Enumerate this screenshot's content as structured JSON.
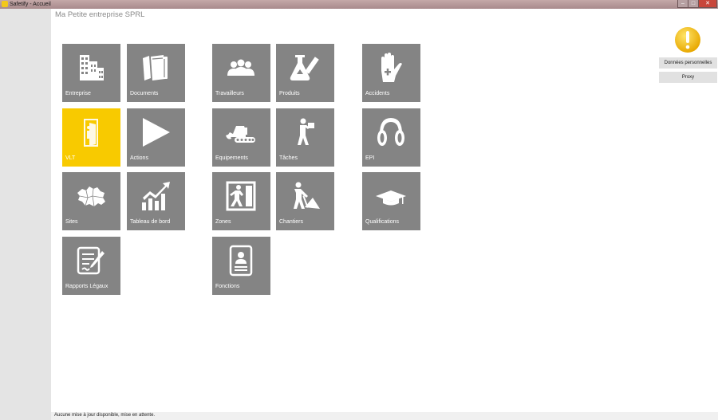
{
  "window": {
    "title": "Safetify - Accueil"
  },
  "company": {
    "name": "Ma Petite entreprise SPRL"
  },
  "tiles": {
    "entreprise": "Entreprise",
    "documents": "Documents",
    "travailleurs": "Travailleurs",
    "produits": "Produits",
    "accidents": "Accidents",
    "vlt": "VLT",
    "actions": "Actions",
    "equipements": "Equipements",
    "taches": "Tâches",
    "epi": "EPI",
    "sites": "Sites",
    "tableau": "Tableau de bord",
    "zones": "Zones",
    "chantiers": "Chantiers",
    "qualifications": "Qualifications",
    "rapports": "Rapports Légaux",
    "fonctions": "Fonctions"
  },
  "right_panel": {
    "personal_data": "Données personnelles",
    "proxy": "Proxy"
  },
  "status": {
    "text": "Aucune mise à jour disponible, mise en attente."
  },
  "colors": {
    "tile": "#848484",
    "tile_active": "#f8ca00",
    "alert": "#f5c400"
  },
  "icons": {
    "entreprise": "buildings-icon",
    "documents": "books-icon",
    "travailleurs": "people-icon",
    "produits": "flask-icon",
    "accidents": "hand-cross-icon",
    "vlt": "door-person-icon",
    "actions": "play-icon",
    "equipements": "excavator-icon",
    "taches": "worker-carry-icon",
    "epi": "ear-protection-icon",
    "sites": "map-icon",
    "tableau": "chart-icon",
    "zones": "exit-sign-icon",
    "chantiers": "construction-worker-icon",
    "qualifications": "graduation-cap-icon",
    "rapports": "report-pen-icon",
    "fonctions": "id-card-icon",
    "alert": "exclamation-icon"
  }
}
